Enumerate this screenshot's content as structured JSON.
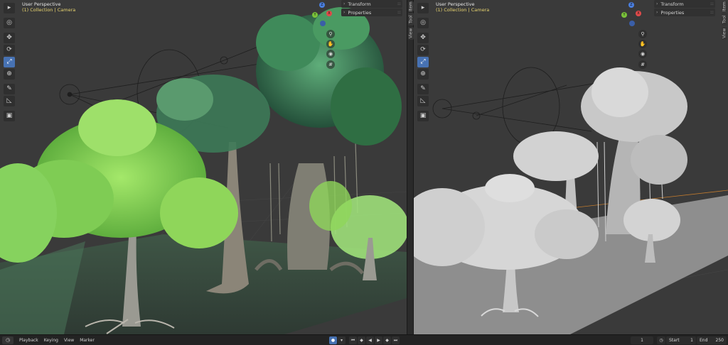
{
  "left_viewport": {
    "perspective": "User Perspective",
    "collection": "(1) Collection | Camera",
    "n_panel": [
      {
        "label": "Transform"
      },
      {
        "label": "Properties"
      }
    ]
  },
  "right_viewport": {
    "perspective": "User Perspective",
    "collection": "(1) Collection | Camera",
    "n_panel": [
      {
        "label": "Transform"
      },
      {
        "label": "Properties"
      }
    ]
  },
  "side_tabs": {
    "item": "Item",
    "tool": "Tool",
    "view": "View"
  },
  "toolbar_icons": [
    "select-box-icon",
    "cursor-icon",
    "move-icon",
    "rotate-icon",
    "scale-icon",
    "transform-icon",
    "annotate-icon",
    "measure-icon",
    "add-cube-icon"
  ],
  "gizmo": {
    "x": "X",
    "y": "Y",
    "z": "Z"
  },
  "statusbar": {
    "playback": "Playback",
    "keying": "Keying",
    "view": "View",
    "marker": "Marker",
    "current_frame": "1",
    "start_label": "Start",
    "start_value": "1",
    "end_label": "End",
    "end_value": "250"
  },
  "colors": {
    "accent": "#4772b3",
    "collection_text": "#e8d470",
    "foliage_light": "#8fd65a",
    "foliage_dark": "#2f6e43",
    "clay": "#b9b9b9"
  }
}
